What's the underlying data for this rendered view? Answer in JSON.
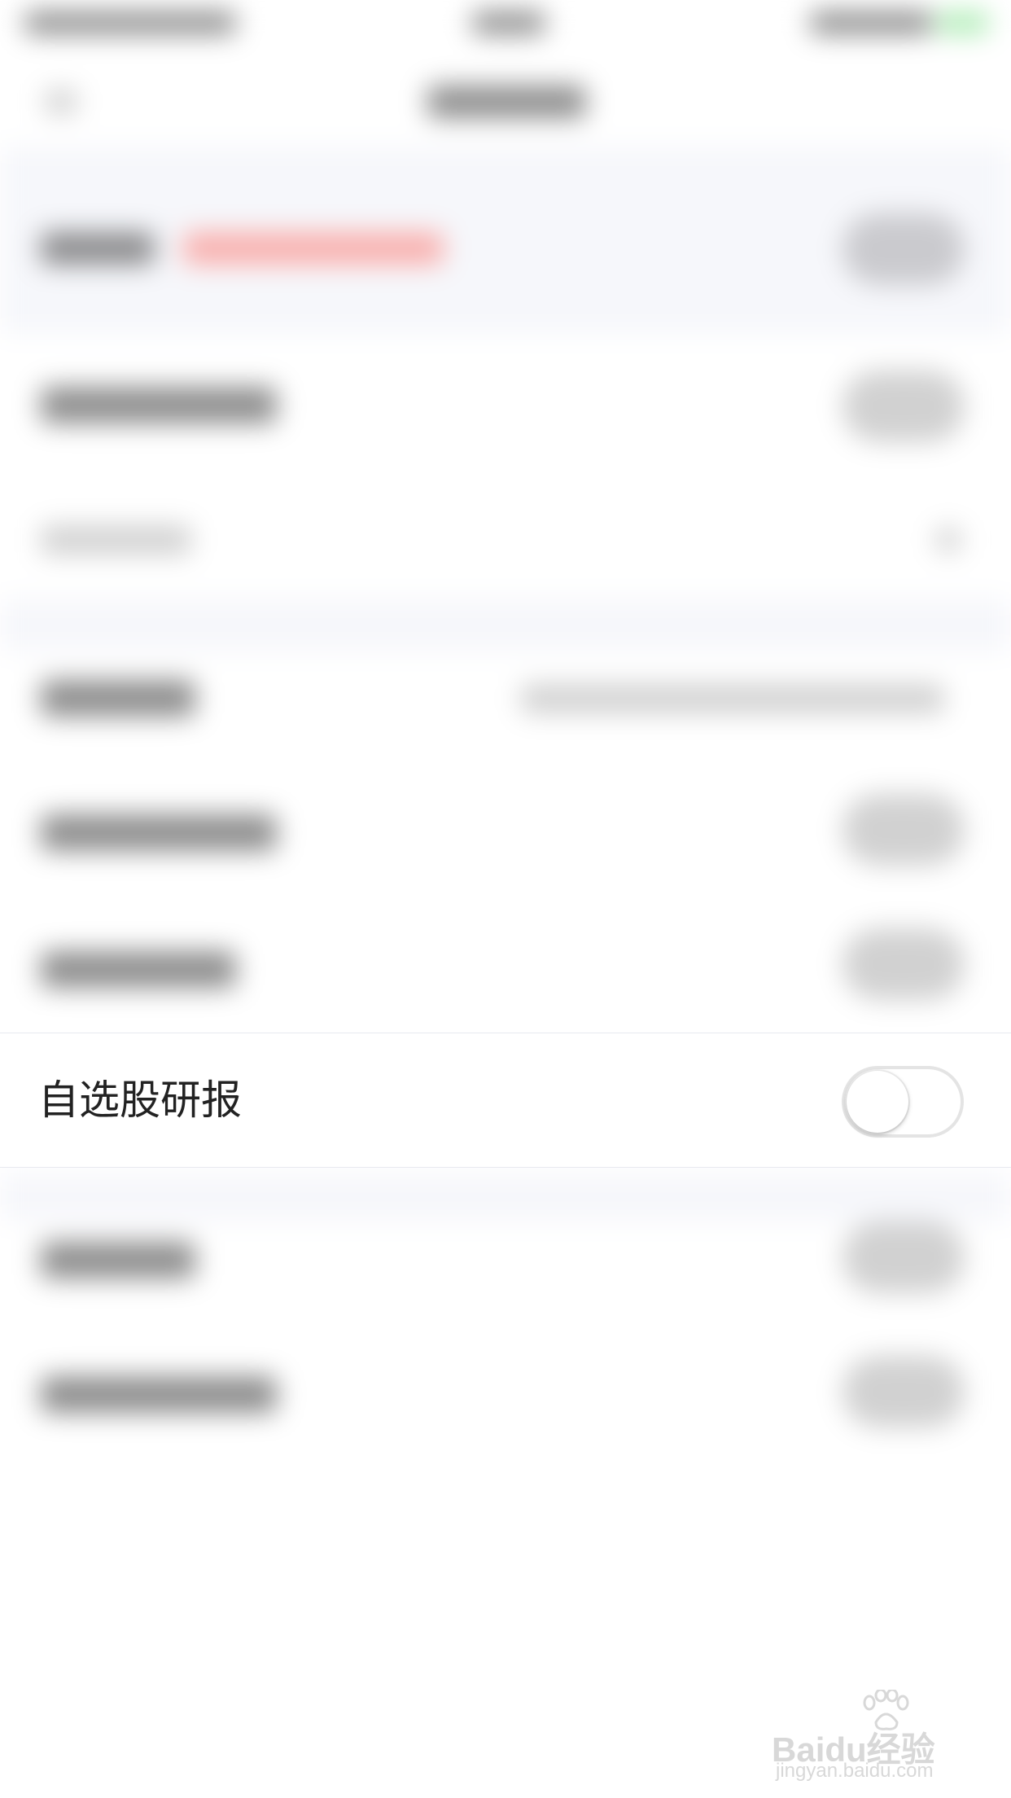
{
  "focused_setting": {
    "label": "自选股研报",
    "toggle_state": "off"
  },
  "watermark": {
    "brand": "Baidu经验",
    "url": "jingyan.baidu.com"
  },
  "colors": {
    "background": "#ffffff",
    "text_primary": "#222222",
    "toggle_border": "#e4e4e4",
    "divider": "#e7e9ef"
  }
}
